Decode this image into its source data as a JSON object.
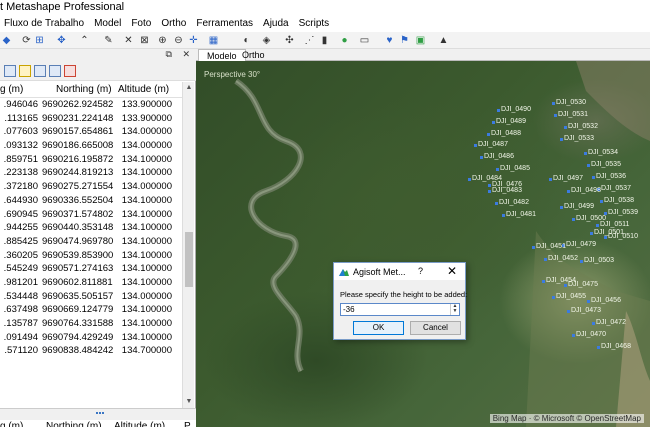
{
  "window": {
    "title": "t Metashape Professional"
  },
  "menu": [
    "Fluxo de Trabalho",
    "Model",
    "Foto",
    "Ortho",
    "Ferramentas",
    "Ajuda",
    "Scripts"
  ],
  "left_panel": {
    "columns": [
      "g (m)",
      "Northing (m)",
      "Altitude (m)"
    ],
    "rows": [
      [
        ".946046",
        "9690262.924582",
        "133.900000"
      ],
      [
        ".113165",
        "9690231.224148",
        "133.900000"
      ],
      [
        ".077603",
        "9690157.654861",
        "134.000000"
      ],
      [
        ".093132",
        "9690186.665008",
        "134.000000"
      ],
      [
        ".859751",
        "9690216.195872",
        "134.100000"
      ],
      [
        ".223138",
        "9690244.819213",
        "134.100000"
      ],
      [
        ".372180",
        "9690275.271554",
        "134.000000"
      ],
      [
        ".644930",
        "9690336.552504",
        "134.100000"
      ],
      [
        ".690945",
        "9690371.574802",
        "134.100000"
      ],
      [
        ".944255",
        "9690440.353148",
        "134.100000"
      ],
      [
        ".885425",
        "9690474.969780",
        "134.100000"
      ],
      [
        ".360205",
        "9690539.853900",
        "134.100000"
      ],
      [
        ".545249",
        "9690571.274163",
        "134.100000"
      ],
      [
        ".981201",
        "9690602.811881",
        "134.100000"
      ],
      [
        ".534448",
        "9690635.505157",
        "134.000000"
      ],
      [
        ".637498",
        "9690669.124779",
        "134.100000"
      ],
      [
        ".135787",
        "9690764.331588",
        "134.100000"
      ],
      [
        ".091494",
        "9690794.429249",
        "134.100000"
      ],
      [
        ".571120",
        "9690838.484242",
        "134.700000"
      ]
    ],
    "bottom_columns": [
      "g (m)",
      "Northing (m)",
      "Altitude (m)",
      "P"
    ]
  },
  "view_tabs": [
    "Modelo",
    "Ortho"
  ],
  "map": {
    "perspective_label": "Perspective 30°",
    "attribution": "Bing Map · © Microsoft © OpenStreetMap",
    "cameras": [
      "DJI_0490",
      "DJI_0530",
      "DJI_0489",
      "DJI_0531",
      "DJI_0488",
      "DJI_0532",
      "DJI_0487",
      "DJI_0533",
      "DJI_0486",
      "DJI_0534",
      "DJI_0485",
      "DJI_0535",
      "DJI_0484",
      "DJI_0536",
      "DJI_0483",
      "DJI_0537",
      "DJI_0482",
      "DJI_0538",
      "DJI_0481",
      "DJI_0539",
      "DJI_0476",
      "DJI_0497",
      "DJI_0498",
      "DJI_0511",
      "DJI_0499",
      "DJI_0510",
      "DJI_0500",
      "DJI_0501",
      "DJI_0479",
      "DJI_0451",
      "DJI_0452",
      "DJI_0503",
      "DJI_0454",
      "DJI_0475",
      "DJI_0455",
      "DJI_0456",
      "DJI_0473",
      "DJI_0472",
      "DJI_0470",
      "DJI_0468"
    ]
  },
  "dialog": {
    "title": "Agisoft Met...",
    "help": "?",
    "close": "✕",
    "prompt": "Please specify the height to be added:",
    "value": "-36",
    "ok": "OK",
    "cancel": "Cancel"
  }
}
